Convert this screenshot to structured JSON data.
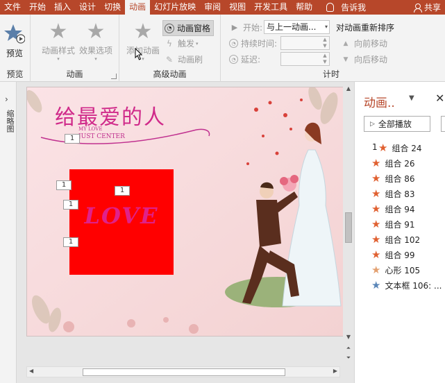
{
  "menubar": {
    "tabs": [
      "文件",
      "开始",
      "插入",
      "设计",
      "切换",
      "动画",
      "幻灯片放映",
      "审阅",
      "视图",
      "开发工具",
      "帮助"
    ],
    "active_tab": "动画",
    "tell_me": "告诉我",
    "share": "共享",
    "colors": {
      "bar": "#b7472a",
      "active_bg": "#f3f3f3"
    }
  },
  "ribbon": {
    "preview": {
      "button": "预览",
      "group": "预览"
    },
    "animation": {
      "style": "动画样式",
      "effect_options": "效果选项",
      "group": "动画"
    },
    "advanced": {
      "add_animation": "添加动画",
      "animation_pane": "动画窗格",
      "trigger": "触发",
      "painter": "动画刷",
      "group": "高级动画"
    },
    "timing": {
      "start_label": "开始:",
      "start_value": "与上一动画...",
      "duration_label": "持续时间:",
      "delay_label": "延迟:",
      "group": "计时"
    },
    "reorder": {
      "title": "对动画重新排序",
      "move_earlier": "向前移动",
      "move_later": "向后移动"
    }
  },
  "left_pane": {
    "label": "缩略图"
  },
  "slide": {
    "logo_text": "给最爱的人",
    "logo_sub_line1": "MY LOVE",
    "logo_sub_line2": "JUST CENTER",
    "love_text": "LOVE",
    "tags": [
      "1",
      "1",
      "1",
      "1",
      "1"
    ],
    "colors": {
      "love_box": "#ff0000",
      "love_text": "#e0218a",
      "bg": "#f8dcdc"
    }
  },
  "anim_pane": {
    "title": "动画..",
    "play_all": "全部播放",
    "first_number": "1",
    "items": [
      {
        "label": "组合 24",
        "icon": "star",
        "color": "#e06030"
      },
      {
        "label": "组合 26",
        "icon": "star",
        "color": "#e06030"
      },
      {
        "label": "组合 86",
        "icon": "star",
        "color": "#e06030"
      },
      {
        "label": "组合 83",
        "icon": "star",
        "color": "#e06030"
      },
      {
        "label": "组合 94",
        "icon": "star",
        "color": "#e06030"
      },
      {
        "label": "组合 91",
        "icon": "star",
        "color": "#e06030"
      },
      {
        "label": "组合 102",
        "icon": "star",
        "color": "#e06030"
      },
      {
        "label": "组合 99",
        "icon": "star",
        "color": "#e06030"
      },
      {
        "label": "心形 105",
        "icon": "star",
        "color": "#e3a070"
      },
      {
        "label": "文本框 106: ...",
        "icon": "star",
        "color": "#5a86b8"
      }
    ]
  }
}
